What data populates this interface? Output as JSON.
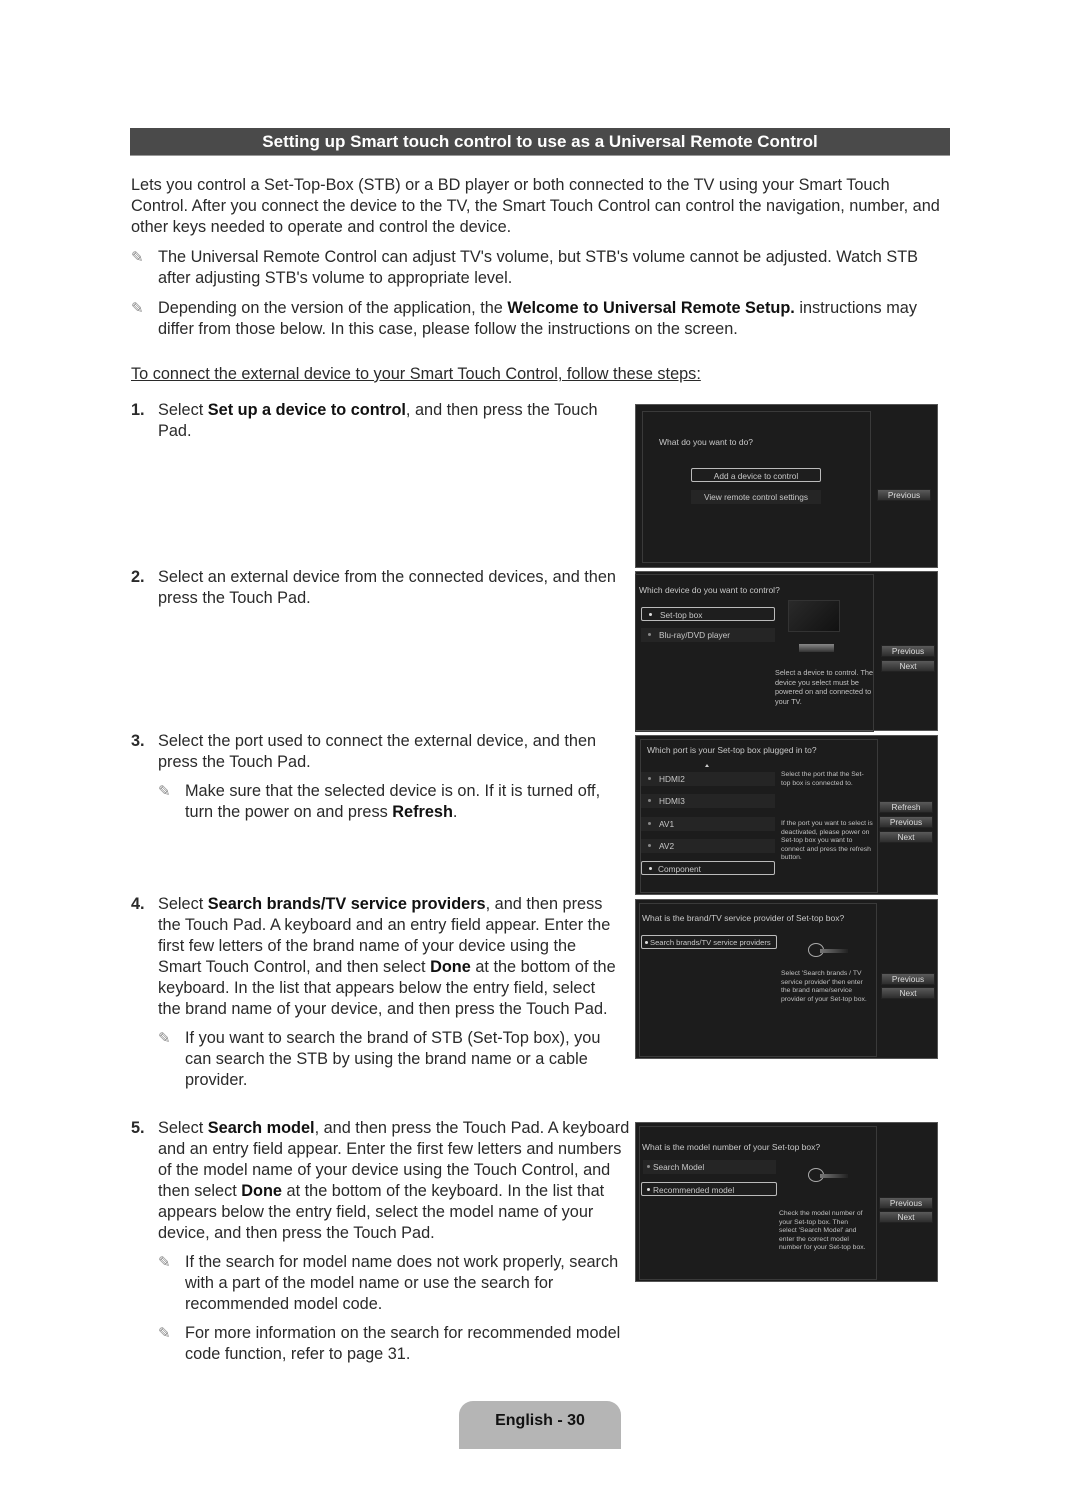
{
  "title": "Setting up Smart touch control to use as a Universal Remote Control",
  "intro": {
    "paragraph": "Lets you control a Set-Top-Box (STB) or a BD player or both connected to the TV using your Smart Touch Control. After you connect the device to the TV, the Smart Touch Control can control the navigation, number, and other keys needed to operate and control the device.",
    "note1": "The Universal Remote Control can adjust TV's volume, but STB's volume cannot be adjusted. Watch STB after adjusting STB's volume to appropriate level.",
    "note2_pre": "Depending on the version of the application, the ",
    "note2_bold": "Welcome to Universal Remote Setup.",
    "note2_post": " instructions may differ from those below. In this case, please follow the instructions on the screen."
  },
  "steps_heading": "To connect the external device to your Smart Touch Control, follow these steps:",
  "steps": [
    {
      "num": "1.",
      "pre": "Select ",
      "bold": "Set up a device to control",
      "post": ", and then press the Touch Pad."
    },
    {
      "num": "2.",
      "text": "Select an external device from the connected devices, and then press the Touch Pad."
    },
    {
      "num": "3.",
      "text": "Select the port used to connect the external device, and then press the Touch Pad.",
      "note_pre": "Make sure that the selected device is on. If it is turned off, turn the power on and press ",
      "note_bold": "Refresh",
      "note_post": "."
    },
    {
      "num": "4.",
      "pre": "Select ",
      "bold": "Search brands/TV service providers",
      "mid": ", and then press the Touch Pad. A keyboard and an entry field appear. Enter the first few letters of the brand name of your device using the Smart Touch Control, and then select ",
      "bold2": "Done",
      "post": " at the bottom of the keyboard. In the list that appears below the entry field, select the brand name of your device, and then press the Touch Pad.",
      "note": "If you want to search the brand of STB (Set-Top box), you can search the STB by using the brand name or a cable provider."
    },
    {
      "num": "5.",
      "pre": "Select ",
      "bold": "Search model",
      "mid": ", and then press the Touch Pad. A keyboard and an entry field appear. Enter the first few letters and numbers of the model name of your device using the Touch Control, and then select ",
      "bold2": "Done",
      "post": " at the bottom of the keyboard. In the list that appears below the entry field, select the model name of your device, and then press the Touch Pad.",
      "note1": "If the search for model name does not work properly, search with a part of the model name or use the search for recommended model code.",
      "note2": "For more information on the search for recommended model code function, refer to page 31."
    }
  ],
  "screens": {
    "s1": {
      "question": "What do you want to do?",
      "options": [
        "Add a device to control",
        "View remote control settings"
      ],
      "buttons": [
        "Previous"
      ]
    },
    "s2": {
      "question": "Which device do you want to control?",
      "options": [
        "Set-top box",
        "Blu-ray/DVD player"
      ],
      "help": "Select a device to control. The device you select must be powered on and connected to your TV.",
      "buttons": [
        "Previous",
        "Next"
      ]
    },
    "s3": {
      "question": "Which port is your Set-top box plugged in to?",
      "options": [
        "HDMI2",
        "HDMI3",
        "AV1",
        "AV2",
        "Component"
      ],
      "help1": "Select the port that the Set-top box is connected to.",
      "help2": "If the port you want to select is deactivated, please power on Set-top box you want to connect and press the refresh button.",
      "buttons": [
        "Refresh",
        "Previous",
        "Next"
      ]
    },
    "s4": {
      "question": "What is the brand/TV service provider of Set-top box?",
      "options": [
        "Search brands/TV service providers"
      ],
      "help": "Select 'Search brands / TV service provider' then enter the brand name/service provider of your Set-top box.",
      "buttons": [
        "Previous",
        "Next"
      ]
    },
    "s5": {
      "question": "What is the model number of your Set-top box?",
      "options": [
        "Search Model",
        "Recommended model"
      ],
      "help": "Check the model number of your Set-top box. Then select 'Search Model' and enter the correct model number for your Set-top box.",
      "buttons": [
        "Previous",
        "Next"
      ]
    }
  },
  "footer": "English - 30",
  "note_icon": "✎"
}
